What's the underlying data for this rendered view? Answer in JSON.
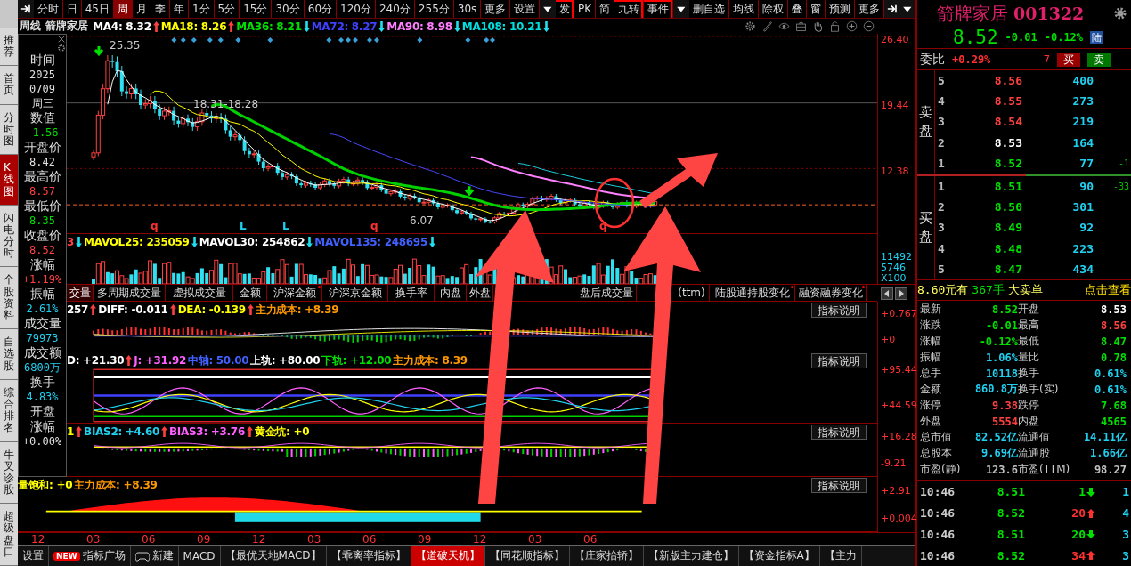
{
  "side_tabs": [
    {
      "label": "推荐",
      "selected": false
    },
    {
      "label": "首页",
      "selected": false
    },
    {
      "label": "分时图",
      "selected": false
    },
    {
      "label": "K线图",
      "selected": true
    },
    {
      "label": "闪电分时",
      "selected": false
    },
    {
      "label": "个股资料",
      "selected": false
    },
    {
      "label": "自选股",
      "selected": false
    },
    {
      "label": "综合排名",
      "selected": false
    },
    {
      "label": "牛叉诊股",
      "selected": false
    },
    {
      "label": "超级盘口",
      "selected": false
    }
  ],
  "toolbar": [
    {
      "label": "分时",
      "selected": false,
      "marked": false
    },
    {
      "label": "日",
      "selected": false,
      "marked": false
    },
    {
      "label": "45日",
      "selected": false,
      "marked": false
    },
    {
      "label": "周",
      "selected": true,
      "marked": false
    },
    {
      "label": "月",
      "selected": false,
      "marked": false
    },
    {
      "label": "季",
      "selected": false,
      "marked": false
    },
    {
      "label": "年",
      "selected": false,
      "marked": false
    },
    {
      "label": "1分",
      "selected": false,
      "marked": false
    },
    {
      "label": "5分",
      "selected": false,
      "marked": false
    },
    {
      "label": "15分",
      "selected": false,
      "marked": false
    },
    {
      "label": "30分",
      "selected": false,
      "marked": false
    },
    {
      "label": "60分",
      "selected": false,
      "marked": false
    },
    {
      "label": "120分",
      "selected": false,
      "marked": false
    },
    {
      "label": "240分",
      "selected": false,
      "marked": false
    },
    {
      "label": "255分",
      "selected": false,
      "marked": false
    },
    {
      "label": "30s",
      "selected": false,
      "marked": false
    },
    {
      "label": "更多",
      "selected": false,
      "marked": false
    },
    {
      "label": "设置",
      "selected": false,
      "marked": false
    }
  ],
  "toolbar_right": [
    {
      "label": "发",
      "marked": true
    },
    {
      "label": "PK",
      "marked": false
    },
    {
      "label": "简",
      "marked": false
    },
    {
      "label": "九转",
      "marked": true
    },
    {
      "label": "事件",
      "marked": true
    }
  ],
  "toolbar_right2": [
    "删自选",
    "均线",
    "除权",
    "叠",
    "窗",
    "预测",
    "更多"
  ],
  "ma_legend": {
    "period": "周线",
    "name": "箭牌家居",
    "items": [
      {
        "kind": "text",
        "text": "MA4: 8.32",
        "color": "#ffffff"
      },
      {
        "kind": "up",
        "color": "#ff4040"
      },
      {
        "kind": "text",
        "text": "MA18: 8.26",
        "color": "#ffff00"
      },
      {
        "kind": "up",
        "color": "#ff4040"
      },
      {
        "kind": "text",
        "text": "MA36: 8.21",
        "color": "#00e000"
      },
      {
        "kind": "down",
        "color": "#20e0f0"
      },
      {
        "kind": "text",
        "text": "MA72: 8.27",
        "color": "#4040ff"
      },
      {
        "kind": "down",
        "color": "#20e0f0"
      },
      {
        "kind": "text",
        "text": "MA90: 8.98",
        "color": "#ff80ff"
      },
      {
        "kind": "down",
        "color": "#20e0f0"
      },
      {
        "kind": "text",
        "text": "MA108: 10.21",
        "color": "#00e0e0"
      },
      {
        "kind": "down",
        "color": "#20e0f0"
      }
    ]
  },
  "info_panel": [
    {
      "label": "时间",
      "values": [
        "2025",
        "0709",
        "周三"
      ],
      "color": "#e0e0e0"
    },
    {
      "label": "数值",
      "values": [
        "-1.56"
      ],
      "color": "#00e000"
    },
    {
      "label": "开盘价",
      "values": [
        "8.42"
      ],
      "color": "#e0e0e0"
    },
    {
      "label": "最高价",
      "values": [
        "8.57"
      ],
      "color": "#ff4040"
    },
    {
      "label": "最低价",
      "values": [
        "8.35"
      ],
      "color": "#00e000"
    },
    {
      "label": "收盘价",
      "values": [
        "8.52"
      ],
      "color": "#ff4040"
    },
    {
      "label": "涨幅",
      "values": [
        "+1.19%"
      ],
      "color": "#ff4040"
    },
    {
      "label": "振幅",
      "values": [
        "2.61%"
      ],
      "color": "#20d0f0"
    },
    {
      "label": "成交量",
      "values": [
        "79973"
      ],
      "color": "#20d0f0"
    },
    {
      "label": "成交额",
      "values": [
        "6800万"
      ],
      "color": "#20d0f0"
    },
    {
      "label": "换手",
      "values": [
        "4.83%"
      ],
      "color": "#20d0f0"
    },
    {
      "label": "开盘"
    },
    {
      "label": "涨幅",
      "values": [
        "+0.00%"
      ],
      "color": "#e0e0e0"
    }
  ],
  "main_chart": {
    "axis": [
      "26.40",
      "19.44",
      "12.38"
    ],
    "high_label": "25.35",
    "range_label": "18.31-18.28",
    "low_label": "6.07",
    "markers": [
      {
        "text": "q",
        "kind": "q"
      },
      {
        "text": "L",
        "kind": "l"
      },
      {
        "text": "L",
        "kind": "l"
      },
      {
        "text": "q",
        "kind": "q"
      },
      {
        "text": "q",
        "kind": "q"
      }
    ]
  },
  "volume": {
    "legend": [
      {
        "kind": "text",
        "text": "3",
        "color": "#ff4040"
      },
      {
        "kind": "down",
        "color": "#20e0f0"
      },
      {
        "kind": "text",
        "text": "MAVOL25: 235059",
        "color": "#ffff00"
      },
      {
        "kind": "down",
        "color": "#20e0f0"
      },
      {
        "kind": "text",
        "text": "MAVOL30: 254862",
        "color": "#ffffff"
      },
      {
        "kind": "down",
        "color": "#20e0f0"
      },
      {
        "kind": "text",
        "text": "MAVOL135: 248695",
        "color": "#4060ff"
      },
      {
        "kind": "down",
        "color": "#20e0f0"
      }
    ],
    "axis": [
      "11492",
      "5746",
      "X100"
    ]
  },
  "indicator_tabs": [
    {
      "label": "交量",
      "selected": true,
      "marked": false
    },
    {
      "label": "多周期成交量",
      "selected": false,
      "marked": false
    },
    {
      "label": "虚拟成交量",
      "selected": false,
      "marked": false
    },
    {
      "label": "金额",
      "selected": false,
      "marked": false
    },
    {
      "label": "沪深金额",
      "selected": false,
      "marked": true
    },
    {
      "label": "沪深京金额",
      "selected": false,
      "marked": false
    },
    {
      "label": "换手率",
      "selected": false,
      "marked": false
    },
    {
      "label": "内盘",
      "selected": false,
      "marked": false
    },
    {
      "label": "外盘",
      "selected": false,
      "marked": false
    },
    {
      "label": "盘后成交量",
      "selected": false,
      "marked": false
    },
    {
      "label": "(ttm)",
      "selected": false,
      "marked": false
    },
    {
      "label": "陆股通持股变化",
      "selected": false,
      "marked": true
    },
    {
      "label": "融资融券变化",
      "selected": false,
      "marked": true
    }
  ],
  "indicators": [
    {
      "kind": "macd",
      "legend": [
        {
          "kind": "text",
          "text": "257",
          "color": "#ffffff"
        },
        {
          "kind": "up",
          "color": "#ff4040"
        },
        {
          "kind": "text",
          "text": "DIFF: -0.011",
          "color": "#ffffff"
        },
        {
          "kind": "up",
          "color": "#ff4040"
        },
        {
          "kind": "text",
          "text": "DEA: -0.139",
          "color": "#ffff00"
        },
        {
          "kind": "up",
          "color": "#ff4040"
        },
        {
          "kind": "text",
          "text": "主力成本: +8.39",
          "color": "#ff9900"
        }
      ],
      "button": "指标说明",
      "axis": [
        "+0.767",
        "+0"
      ]
    },
    {
      "kind": "kdj",
      "legend": [
        {
          "kind": "text",
          "text": "D: +21.30",
          "color": "#ffffff"
        },
        {
          "kind": "up",
          "color": "#ff4040"
        },
        {
          "kind": "text",
          "text": "J: +31.92",
          "color": "#ff60ff"
        },
        {
          "kind": "text",
          "text": "中轴: 50.00",
          "color": "#4060ff"
        },
        {
          "kind": "text",
          "text": "上轨: +80.00",
          "color": "#ffffff"
        },
        {
          "kind": "text",
          "text": "下轨: +12.00",
          "color": "#00e000"
        },
        {
          "kind": "text",
          "text": "主力成本: 8.39",
          "color": "#ff9900"
        }
      ],
      "button": "指标说明",
      "axis": [
        "+95.44",
        "+44.59"
      ]
    },
    {
      "kind": "bias",
      "legend": [
        {
          "kind": "text",
          "text": "1",
          "color": "#ffff00"
        },
        {
          "kind": "up",
          "color": "#ff4040"
        },
        {
          "kind": "text",
          "text": "BIAS2: +4.60",
          "color": "#20d0f0"
        },
        {
          "kind": "up",
          "color": "#ff4040"
        },
        {
          "kind": "text",
          "text": "BIAS3: +3.76",
          "color": "#ff60ff"
        },
        {
          "kind": "up",
          "color": "#ff4040"
        },
        {
          "kind": "text",
          "text": "黄金坑: +0",
          "color": "#ffff00"
        }
      ],
      "button": "指标说明",
      "axis": [
        "+16.28",
        "-9.21"
      ]
    },
    {
      "kind": "saturation",
      "legend": [
        {
          "kind": "text",
          "text": "量饱和: +0",
          "color": "#ffff00"
        },
        {
          "kind": "text",
          "text": "主力成本: +8.39",
          "color": "#ff9900"
        }
      ],
      "button": "指标说明",
      "axis": [
        "+2.91",
        "+0.004"
      ]
    }
  ],
  "dates": [
    "12",
    "03",
    "06",
    "09",
    "12",
    "03",
    "06",
    "09",
    "12",
    "03",
    "06"
  ],
  "bottom_tabs": [
    {
      "label": "设置",
      "kind": "plain",
      "selected": false
    },
    {
      "label": "指标广场",
      "kind": "new",
      "badge": "NEW",
      "selected": false
    },
    {
      "label": "新建",
      "kind": "icon",
      "selected": false
    },
    {
      "label": "MACD",
      "kind": "plain",
      "selected": false
    },
    {
      "label": "【最优天地MACD】",
      "kind": "plain",
      "selected": false
    },
    {
      "label": "【乖离率指标】",
      "kind": "plain",
      "selected": false
    },
    {
      "label": "【道破天机】",
      "kind": "plain",
      "selected": true
    },
    {
      "label": "【同花顺指标】",
      "kind": "plain",
      "selected": false
    },
    {
      "label": "【庄家抬轿】",
      "kind": "plain",
      "selected": false
    },
    {
      "label": "【新版主力建仓】",
      "kind": "plain",
      "selected": false
    },
    {
      "label": "【资金指标A】",
      "kind": "plain",
      "selected": false
    },
    {
      "label": "【主力",
      "kind": "plain",
      "selected": false
    }
  ],
  "quote": {
    "name": "箭牌家居",
    "code": "001322",
    "price": "8.52",
    "change": "-0.01",
    "pct": "-0.12%",
    "market": "陆",
    "ratio_label": "委比",
    "ratio": "+0.29%",
    "diff": "7",
    "buy": "买",
    "sell": "卖",
    "sell_label": "卖盘",
    "buy_label": "买盘",
    "asks": [
      {
        "level": "5",
        "price": "8.56",
        "color": "#ff4040",
        "vol": "400"
      },
      {
        "level": "4",
        "price": "8.55",
        "color": "#ff4040",
        "vol": "273"
      },
      {
        "level": "3",
        "price": "8.54",
        "color": "#ff4040",
        "vol": "219"
      },
      {
        "level": "2",
        "price": "8.53",
        "color": "#ffffff",
        "vol": "164"
      },
      {
        "level": "1",
        "price": "8.52",
        "color": "#00e000",
        "vol": "77",
        "change": "-1"
      }
    ],
    "bids": [
      {
        "level": "1",
        "price": "8.51",
        "color": "#00e000",
        "vol": "90",
        "change": "-33"
      },
      {
        "level": "2",
        "price": "8.50",
        "color": "#00e000",
        "vol": "301"
      },
      {
        "level": "3",
        "price": "8.49",
        "color": "#00e000",
        "vol": "92"
      },
      {
        "level": "4",
        "price": "8.48",
        "color": "#00e000",
        "vol": "223"
      },
      {
        "level": "5",
        "price": "8.47",
        "color": "#00e000",
        "vol": "434"
      }
    ],
    "ad": {
      "price": "8.60元有",
      "qty": "367手",
      "kind": "大卖单",
      "link": "点击查看"
    },
    "stats": [
      {
        "cells": [
          {
            "label": "最新",
            "value": "8.52",
            "color": "#00e000"
          },
          {
            "label": "开盘",
            "value": "8.53",
            "color": "#ffffff"
          }
        ]
      },
      {
        "cells": [
          {
            "label": "涨跌",
            "value": "-0.01",
            "color": "#00e000"
          },
          {
            "label": "最高",
            "value": "8.56",
            "color": "#ff4040"
          }
        ]
      },
      {
        "cells": [
          {
            "label": "涨幅",
            "value": "-0.12%",
            "color": "#00e000"
          },
          {
            "label": "最低",
            "value": "8.47",
            "color": "#00e000"
          }
        ]
      },
      {
        "cells": [
          {
            "label": "振幅",
            "value": "1.06%",
            "color": "#20d0f0"
          },
          {
            "label": "量比",
            "value": "0.78",
            "color": "#00e000"
          }
        ]
      },
      {
        "cells": [
          {
            "label": "总手",
            "value": "10118",
            "color": "#20d0f0"
          },
          {
            "label": "换手",
            "value": "0.61%",
            "color": "#20d0f0"
          }
        ]
      },
      {
        "cells": [
          {
            "label": "金额",
            "value": "860.8万",
            "color": "#20d0f0"
          },
          {
            "label": "换手(实)",
            "value": "0.61%",
            "color": "#20d0f0"
          }
        ]
      },
      {
        "cells": [
          {
            "label": "涨停",
            "value": "9.38",
            "color": "#ff4040"
          },
          {
            "label": "跌停",
            "value": "7.68",
            "color": "#00e000"
          }
        ]
      },
      {
        "cells": [
          {
            "label": "外盘",
            "value": "5554",
            "color": "#ff4040"
          },
          {
            "label": "内盘",
            "value": "4565",
            "color": "#00e000"
          }
        ]
      },
      {
        "cells": [
          {
            "label": "总市值",
            "value": "82.52亿",
            "color": "#20d0f0"
          },
          {
            "label": "流通值",
            "value": "14.11亿",
            "color": "#20d0f0"
          }
        ]
      },
      {
        "cells": [
          {
            "label": "总股本",
            "value": "9.69亿",
            "color": "#20d0f0"
          },
          {
            "label": "流通股",
            "value": "1.66亿",
            "color": "#20d0f0"
          }
        ]
      },
      {
        "cells": [
          {
            "label": "市盈(静)",
            "value": "123.6",
            "color": "#c0c0c0"
          },
          {
            "label": "市盈(TTM)",
            "value": "98.27",
            "color": "#c0c0c0"
          }
        ]
      }
    ],
    "ticks": [
      {
        "time": "10:46",
        "price": "8.51",
        "vol": "1",
        "kind": "down",
        "last": "1"
      },
      {
        "time": "10:46",
        "price": "8.52",
        "vol": "20",
        "kind": "up",
        "last": "4"
      },
      {
        "time": "10:46",
        "price": "8.51",
        "vol": "20",
        "kind": "down",
        "last": "3"
      },
      {
        "time": "10:46",
        "price": "8.52",
        "vol": "34",
        "kind": "up",
        "last": "3"
      }
    ]
  }
}
